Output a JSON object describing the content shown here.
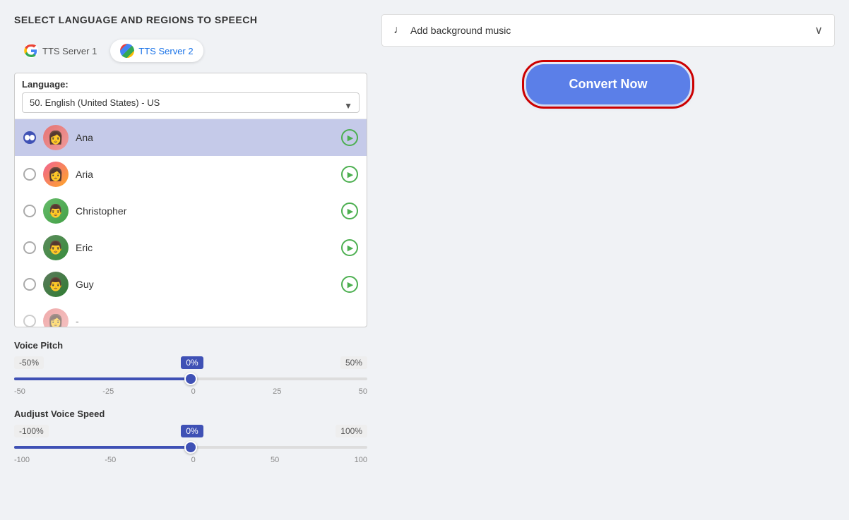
{
  "page": {
    "title": "SELECT LANGUAGE AND REGIONS TO SPEECH"
  },
  "servers": {
    "tab1": {
      "label": "TTS Server 1"
    },
    "tab2": {
      "label": "TTS Server 2"
    },
    "active": "tab2"
  },
  "language": {
    "label": "Language:",
    "selected": "50. English (United States) - US",
    "options": [
      "50. English (United States) - US"
    ]
  },
  "voices": [
    {
      "id": "ana",
      "name": "Ana",
      "selected": true,
      "avatar_class": "avatar-ana",
      "emoji": "👩"
    },
    {
      "id": "aria",
      "name": "Aria",
      "selected": false,
      "avatar_class": "avatar-aria",
      "emoji": "👩"
    },
    {
      "id": "christopher",
      "name": "Christopher",
      "selected": false,
      "avatar_class": "avatar-christopher",
      "emoji": "👨"
    },
    {
      "id": "eric",
      "name": "Eric",
      "selected": false,
      "avatar_class": "avatar-eric",
      "emoji": "👨"
    },
    {
      "id": "guy",
      "name": "Guy",
      "selected": false,
      "avatar_class": "avatar-guy",
      "emoji": "👨"
    },
    {
      "id": "partial",
      "name": "-",
      "selected": false,
      "avatar_class": "avatar-partial",
      "emoji": "👩"
    }
  ],
  "voice_pitch": {
    "label": "Voice Pitch",
    "min_label": "-50%",
    "max_label": "50%",
    "current_label": "0%",
    "value": 0,
    "min": -50,
    "max": 50,
    "ticks": [
      "-50",
      "-25",
      "0",
      "25",
      "50"
    ],
    "thumb_percent": 50
  },
  "voice_speed": {
    "label": "Audjust Voice Speed",
    "min_label": "-100%",
    "max_label": "100%",
    "current_label": "0%",
    "value": 0,
    "min": -100,
    "max": 100,
    "ticks": [
      "-100",
      "-50",
      "0",
      "50",
      "100"
    ],
    "thumb_percent": 50
  },
  "background_music": {
    "label": "Add background music"
  },
  "convert": {
    "button_label": "Convert Now"
  }
}
